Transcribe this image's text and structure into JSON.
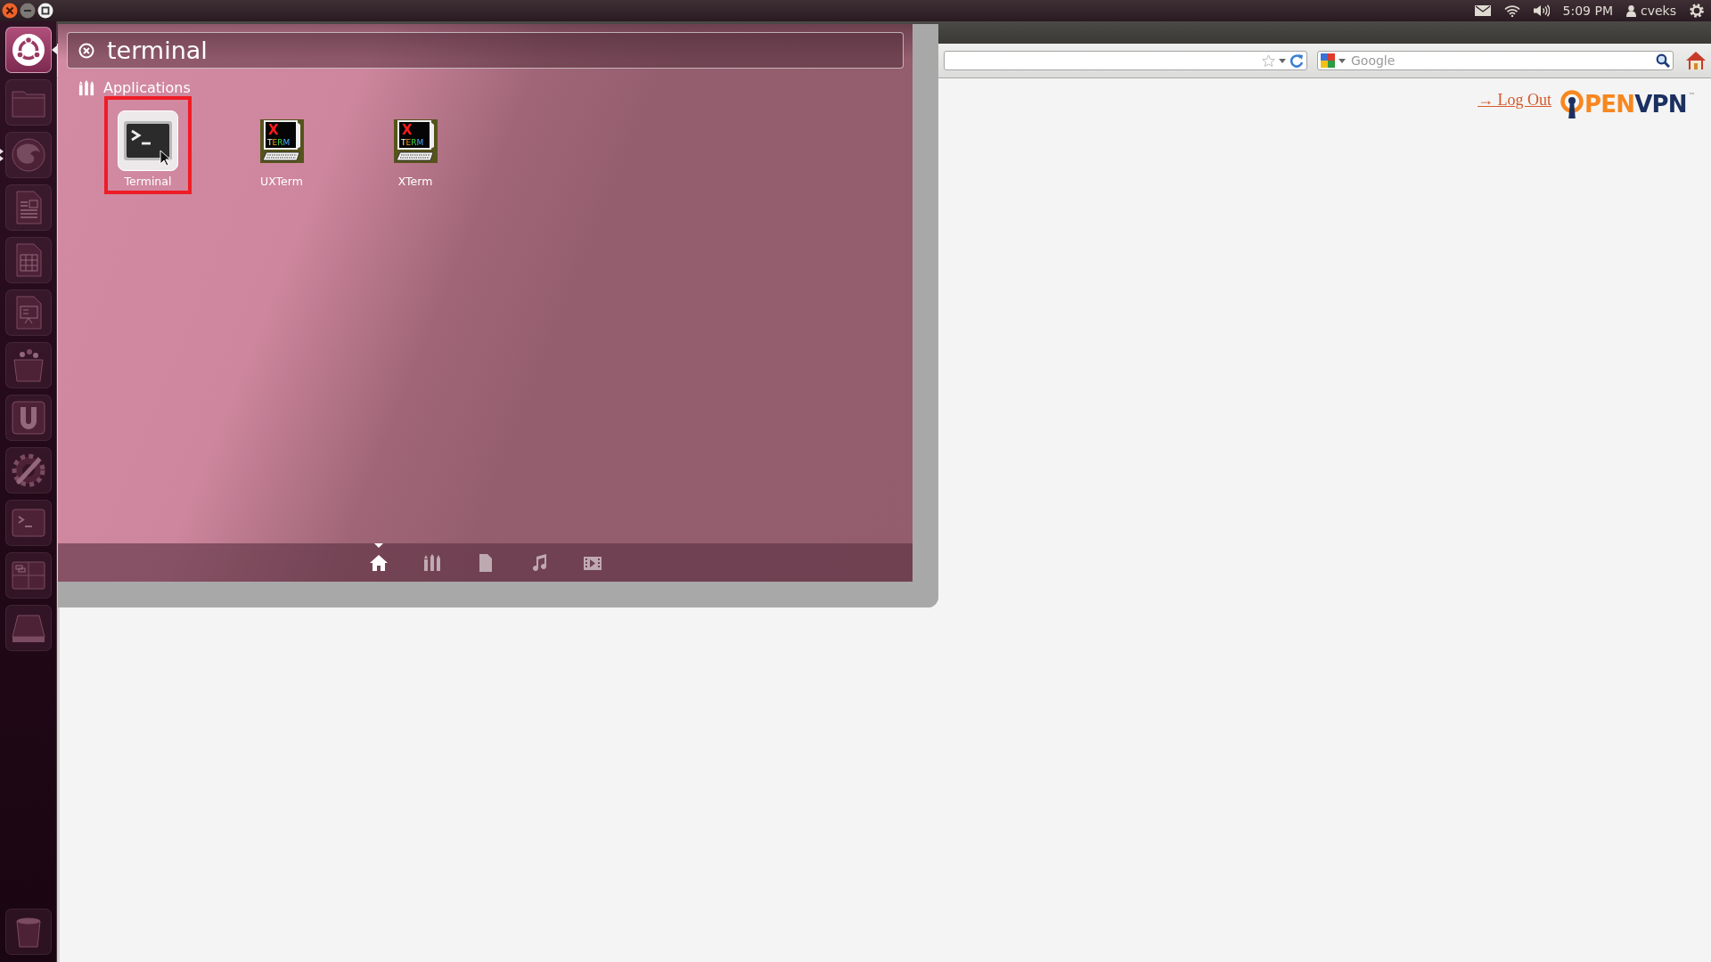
{
  "top_panel": {
    "clock": "5:09 PM",
    "user": "cveks"
  },
  "launcher": {
    "items": [
      {
        "kind": "dash",
        "focused": true,
        "running": false
      },
      {
        "kind": "files",
        "focused": false,
        "running": false
      },
      {
        "kind": "browser",
        "focused": false,
        "running": true
      },
      {
        "kind": "writer",
        "focused": false,
        "running": false
      },
      {
        "kind": "calc",
        "focused": false,
        "running": false
      },
      {
        "kind": "impress",
        "focused": false,
        "running": false
      },
      {
        "kind": "software",
        "focused": false,
        "running": false
      },
      {
        "kind": "ubuntu-one",
        "focused": false,
        "running": false
      },
      {
        "kind": "settings",
        "focused": false,
        "running": false
      },
      {
        "kind": "terminal",
        "focused": false,
        "running": false
      },
      {
        "kind": "workspaces",
        "focused": false,
        "running": false
      },
      {
        "kind": "drive",
        "focused": false,
        "running": false
      }
    ]
  },
  "browser": {
    "search_field": {
      "placeholder": "Google"
    },
    "logout_link": "→ Log Out",
    "logo": {
      "left": "PEN",
      "right": "VPN",
      "trademark": "™"
    }
  },
  "dash": {
    "search": {
      "value": "terminal"
    },
    "category": "Applications",
    "results": [
      {
        "kind": "terminal",
        "label": "Terminal",
        "selected": true
      },
      {
        "kind": "xterm",
        "label": "UXTerm",
        "selected": false,
        "icon_text": {
          "top": "X",
          "bottom": "TERM"
        }
      },
      {
        "kind": "xterm",
        "label": "XTerm",
        "selected": false,
        "icon_text": {
          "top": "X",
          "bottom": "TERM"
        }
      }
    ],
    "lenses": [
      {
        "kind": "home",
        "selected": true
      },
      {
        "kind": "applications",
        "selected": false
      },
      {
        "kind": "files",
        "selected": false
      },
      {
        "kind": "music",
        "selected": false
      },
      {
        "kind": "video",
        "selected": false
      }
    ]
  }
}
